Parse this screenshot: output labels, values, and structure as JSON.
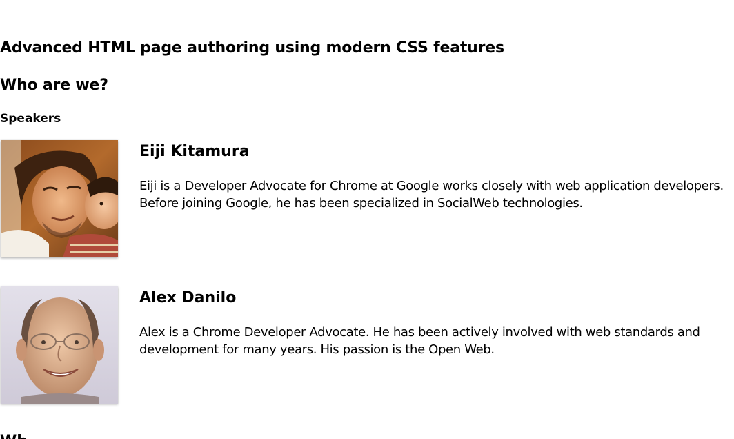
{
  "page": {
    "title": "Advanced HTML page authoring using modern CSS features",
    "section_heading": "Who are we?",
    "subsection_heading": "Speakers",
    "next_heading": "Wh"
  },
  "speakers": [
    {
      "name": "Eiji Kitamura",
      "bio": "Eiji is a Developer Advocate for Chrome at Google works closely with web application developers. Before joining Google, he has been specialized in SocialWeb technologies.",
      "photo_icon": "person-photo"
    },
    {
      "name": "Alex Danilo",
      "bio": "Alex is a Chrome Developer Advocate. He has been actively involved with web standards and development for many years. His passion is the Open Web.",
      "photo_icon": "person-photo"
    }
  ]
}
